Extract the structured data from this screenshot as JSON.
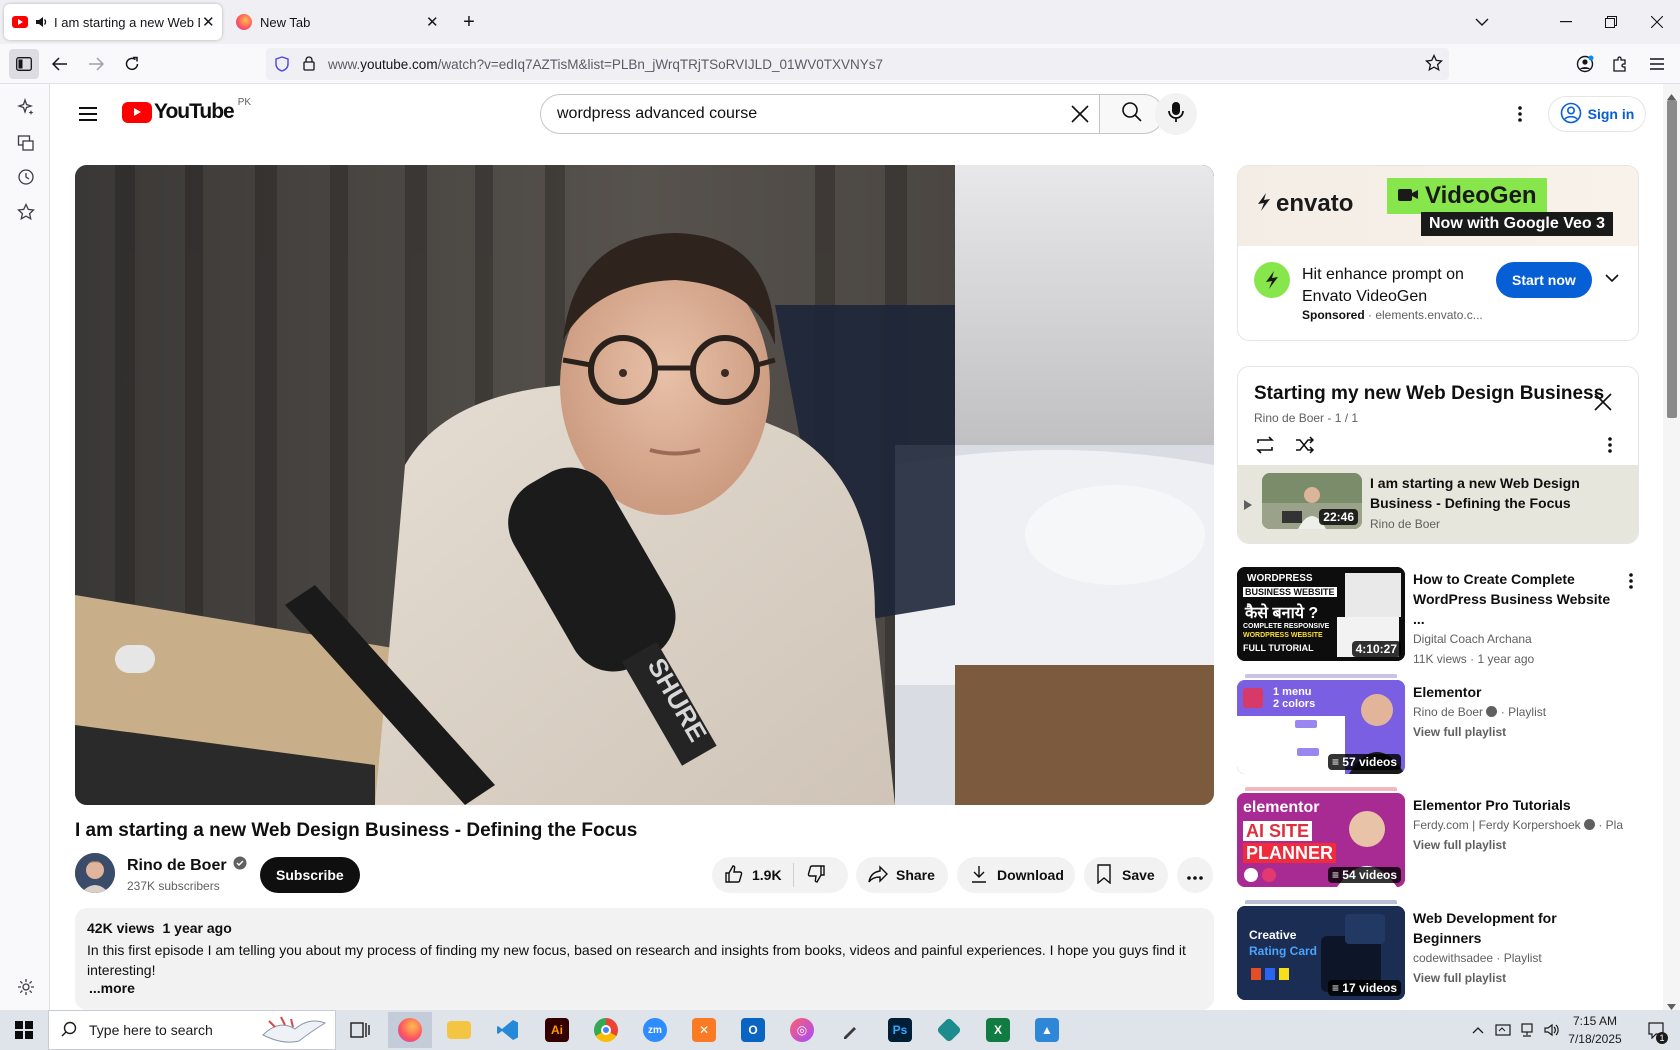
{
  "browser": {
    "tabs": [
      {
        "label": "I am starting a new Web De",
        "active": true
      },
      {
        "label": "New Tab",
        "active": false
      }
    ],
    "url_prefix": "www.",
    "url_domain": "youtube.com",
    "url_path": "/watch?v=edIq7AZTisM&list=PLBn_jWrqTRjTSoRVIJLD_01WV0TXVNYs7"
  },
  "youtube": {
    "logo_text": "YouTube",
    "region": "PK",
    "search_value": "wordpress advanced course",
    "sign_in": "Sign in"
  },
  "video": {
    "title": "I am starting a new Web Design Business - Defining the Focus",
    "channel": "Rino de Boer",
    "subscribers": "237K subscribers",
    "subscribe_label": "Subscribe",
    "likes": "1.9K",
    "share_label": "Share",
    "download_label": "Download",
    "save_label": "Save",
    "mic_brand": "SHURE",
    "views": "42K views",
    "age": "1 year ago",
    "description": "In this first episode I am telling you about my process of finding my new focus, based on research and insights from books, videos and painful experiences. I hope you guys find it interesting!",
    "more_label": "...more"
  },
  "ad": {
    "brand": "envato",
    "product": "VideoGen",
    "tagline": "Now with Google Veo 3",
    "headline": "Hit enhance prompt on Envato VideoGen",
    "sponsored": "Sponsored",
    "domain": "elements.envato.c...",
    "cta": "Start now"
  },
  "playlist": {
    "title": "Starting my new Web Design Business",
    "subtitle": "Rino de Boer - 1 / 1",
    "item_title": "I am starting a new Web Design Business - Defining the Focus",
    "item_channel": "Rino de Boer",
    "item_duration": "22:46"
  },
  "recommendations": [
    {
      "title": "How to Create Complete WordPress Business Website ...",
      "channel": "Digital Coach Archana",
      "stats": "11K views · 1 year ago",
      "badge": "4:10:27",
      "thumb_lines": [
        "WORDPRESS",
        "BUSINESS WEBSITE",
        "कैसे बनाये ?",
        "COMPLETE RESPONSIVE",
        "WORDPRESS WEBSITE",
        "FULL TUTORIAL"
      ]
    },
    {
      "title": "Elementor",
      "channel": "Rino de Boer",
      "playlist_tag": "· Playlist",
      "link": "View full playlist",
      "badge": "57 videos",
      "thumb_lines": [
        "1 menu",
        "2 colors"
      ]
    },
    {
      "title": "Elementor Pro Tutorials",
      "channel": "Ferdy.com | Ferdy Korpershoek",
      "playlist_tag": "· Play...",
      "link": "View full playlist",
      "badge": "54 videos",
      "thumb_lines": [
        "elementor",
        "AI SITE",
        "PLANNER"
      ]
    },
    {
      "title": "Web Development for Beginners",
      "channel": "codewithsadee",
      "playlist_tag": "· Playlist",
      "link": "View full playlist",
      "badge": "17 videos",
      "thumb_lines": [
        "Creative",
        "Rating Card"
      ]
    }
  ],
  "taskbar": {
    "search_placeholder": "Type here to search",
    "time": "7:15 AM",
    "date": "7/18/2025",
    "notifications": "1"
  }
}
